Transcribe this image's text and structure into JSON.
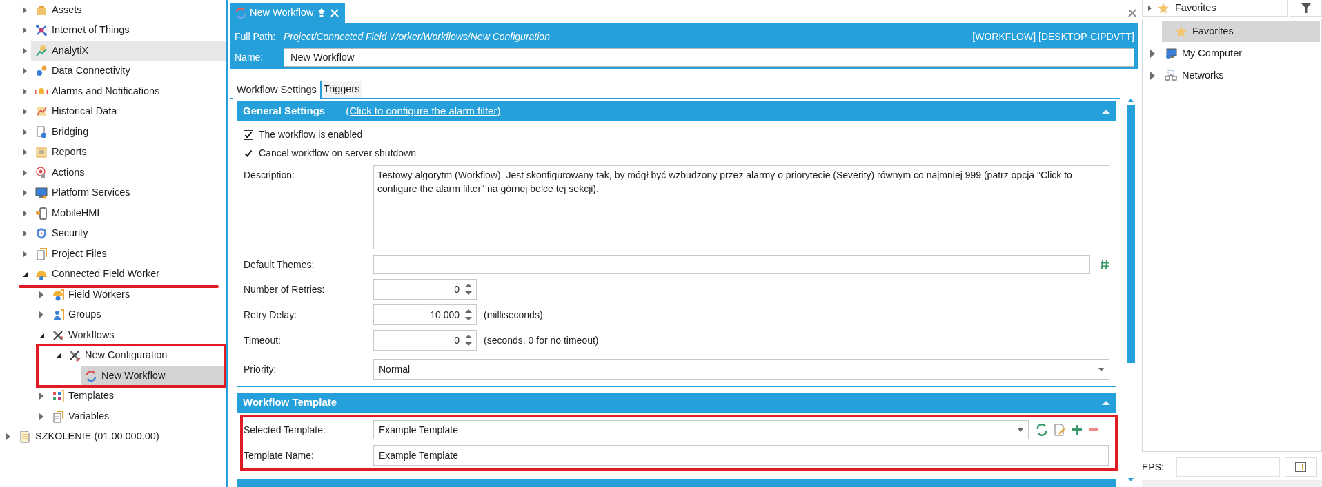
{
  "project_tree": {
    "items": [
      {
        "children": [
          {
            "label": "Assets",
            "expanded": false,
            "selected": false,
            "hovered": false
          },
          {
            "label": "Internet of Things",
            "expanded": false,
            "selected": false,
            "hovered": false
          },
          {
            "label": "AnalytiX",
            "expanded": false,
            "selected": false,
            "hovered": true
          },
          {
            "label": "Data Connectivity",
            "expanded": false,
            "selected": false,
            "hovered": false
          },
          {
            "label": "Alarms and Notifications",
            "expanded": false,
            "selected": false,
            "hovered": false
          },
          {
            "label": "Historical Data",
            "expanded": false,
            "selected": false,
            "hovered": false
          },
          {
            "label": "Bridging",
            "expanded": false,
            "selected": false,
            "hovered": false
          },
          {
            "label": "Reports",
            "expanded": false,
            "selected": false,
            "hovered": false
          },
          {
            "label": "Actions",
            "expanded": false,
            "selected": false,
            "hovered": false
          },
          {
            "label": "Platform Services",
            "expanded": false,
            "selected": false,
            "hovered": false
          },
          {
            "label": "MobileHMI",
            "expanded": false,
            "selected": false,
            "hovered": false
          },
          {
            "label": "Security",
            "expanded": false,
            "selected": false,
            "hovered": false
          },
          {
            "label": "Project Files",
            "expanded": false,
            "selected": false,
            "hovered": false
          },
          {
            "label": "Connected Field Worker",
            "expanded": true,
            "selected": false,
            "hovered": false,
            "children": [
              {
                "label": "Field Workers",
                "expanded": false,
                "selected": false,
                "hovered": false
              },
              {
                "label": "Groups",
                "expanded": false,
                "selected": false,
                "hovered": false
              },
              {
                "label": "Workflows",
                "expanded": true,
                "selected": false,
                "hovered": false,
                "children": [
                  {
                    "label": "New Configuration",
                    "expanded": true,
                    "selected": false,
                    "hovered": false,
                    "children": [
                      {
                        "label": "New Workflow",
                        "selected": true,
                        "hovered": false
                      }
                    ]
                  }
                ]
              },
              {
                "label": "Templates",
                "expanded": false,
                "selected": false,
                "hovered": false
              },
              {
                "label": "Variables",
                "expanded": false,
                "selected": false,
                "hovered": false
              }
            ]
          }
        ]
      },
      {
        "label": "SZKOLENIE (01.00.000.00)",
        "expanded": false,
        "selected": false,
        "hovered": false
      }
    ]
  },
  "document_tab": {
    "label": "New Workflow"
  },
  "details": {
    "full_path_label": "Full Path:",
    "full_path": "Project/Connected Field Worker/Workflows/New Configuration",
    "identity": "[WORKFLOW] [DESKTOP-CIPDVTT]",
    "name_label": "Name:",
    "name": "New Workflow"
  },
  "tabs": [
    {
      "label": "Workflow Settings",
      "selected": true
    },
    {
      "label": "Triggers",
      "selected": false
    }
  ],
  "sections": [
    {
      "title": "General Settings",
      "link": "(Click to configure the alarm filter)",
      "expanded": true,
      "fields": [
        {
          "kind": "checkbox",
          "label": "The workflow is enabled",
          "checked": true
        },
        {
          "kind": "checkbox",
          "label": "Cancel workflow on server shutdown",
          "checked": true
        },
        {
          "kind": "textarea",
          "label": "Description:",
          "value": "Testowy algorytm (Workflow). Jest skonfigurowany tak, by mógł być wzbudzony przez alarmy o priorytecie (Severity) równym co najmniej 999 (patrz opcja \"Click to configure the alarm filter\" na górnej belce tej sekcji)."
        },
        {
          "kind": "text_button",
          "label": "Default Themes:"
        },
        {
          "kind": "spinner",
          "label": "Number of Retries:",
          "value": "0"
        },
        {
          "kind": "spinner",
          "label": "Retry Delay:",
          "value": "10 000",
          "unit": "(milliseconds)"
        },
        {
          "kind": "spinner",
          "label": "Timeout:",
          "value": "0",
          "unit": "(seconds, 0 for no timeout)"
        },
        {
          "kind": "select",
          "label": "Priority:",
          "value": "Normal"
        }
      ]
    },
    {
      "title": "Workflow Template",
      "expanded": true,
      "fields": [
        {
          "kind": "select_tools",
          "label": "Selected Template:",
          "value": "Example Template"
        },
        {
          "kind": "text",
          "label": "Template Name:",
          "value": "Example Template"
        }
      ]
    }
  ],
  "explorer": {
    "filter": "Favorites",
    "items": [
      {
        "label": "Favorites",
        "selected": true
      },
      {
        "label": "My Computer",
        "expanded": false,
        "selected": false
      },
      {
        "label": "Networks",
        "expanded": false,
        "selected": false
      }
    ],
    "eps_label": "EPS:"
  }
}
